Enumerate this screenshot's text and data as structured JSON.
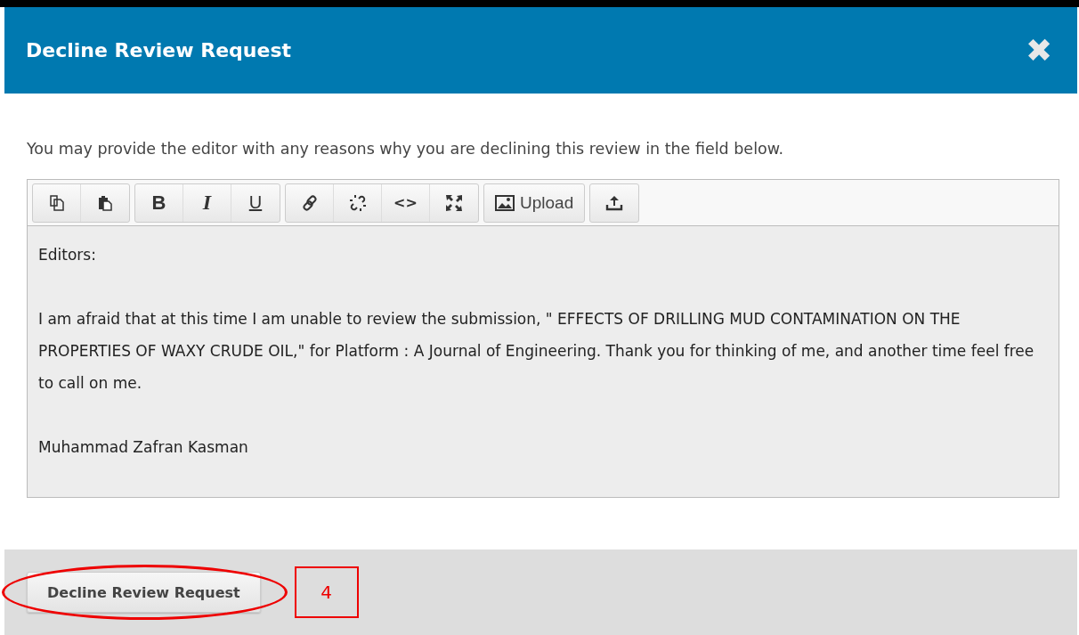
{
  "dialog": {
    "title": "Decline Review Request",
    "close_icon": "✖"
  },
  "instructions": "You may provide the editor with any reasons why you are declining this review in the field below.",
  "toolbar": [
    [
      {
        "kind": "copy"
      },
      {
        "kind": "paste"
      }
    ],
    [
      {
        "kind": "bold",
        "label": "B"
      },
      {
        "kind": "italic",
        "label": "I"
      },
      {
        "kind": "underline",
        "label": "U"
      }
    ],
    [
      {
        "kind": "link"
      },
      {
        "kind": "unlink"
      },
      {
        "kind": "code",
        "label": "<>"
      },
      {
        "kind": "fullscreen"
      }
    ],
    [
      {
        "kind": "upload",
        "label": "Upload"
      }
    ],
    [
      {
        "kind": "export"
      }
    ]
  ],
  "editor": {
    "paragraphs": [
      "Editors:",
      "I am afraid that at this time I am unable to review the submission, \" EFFECTS OF DRILLING MUD CONTAMINATION ON THE PROPERTIES OF WAXY CRUDE OIL,\" for Platform : A Journal of Engineering. Thank you for thinking of me, and another time feel free to call on me.",
      "Muhammad Zafran Kasman"
    ]
  },
  "footer": {
    "button": "Decline Review Request",
    "callout": "4"
  }
}
